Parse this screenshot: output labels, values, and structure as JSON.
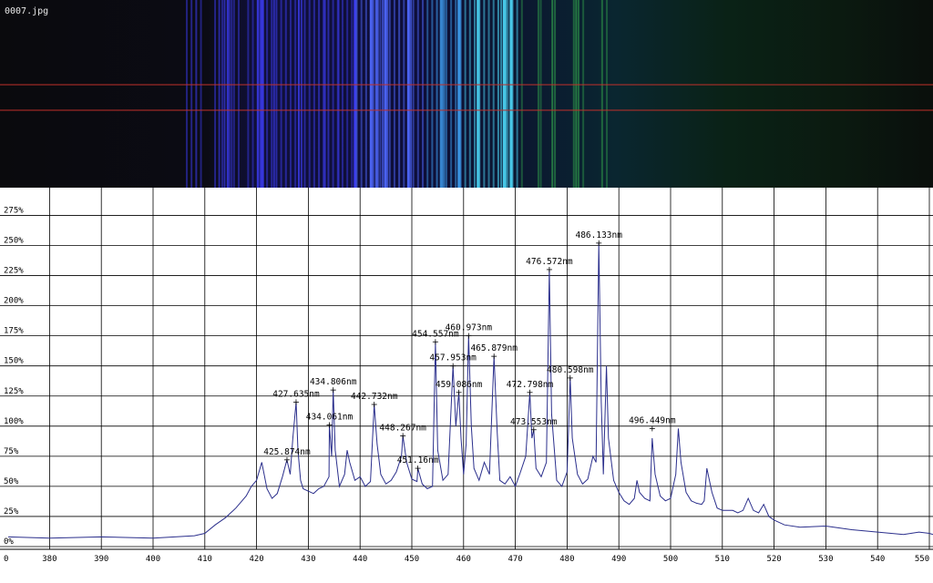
{
  "image": {
    "filename": "0007.jpg"
  },
  "chart_data": {
    "type": "line",
    "xlabel": "",
    "ylabel": "",
    "xlim": [
      372,
      552
    ],
    "ylim": [
      0,
      295
    ],
    "grid": true,
    "x_ticks": [
      "0",
      "380",
      "390",
      "400",
      "410",
      "420",
      "430",
      "440",
      "450",
      "460",
      "470",
      "480",
      "490",
      "500",
      "510",
      "520",
      "530",
      "540",
      "550"
    ],
    "x_tick_values": [
      372,
      380,
      390,
      400,
      410,
      420,
      430,
      440,
      450,
      460,
      470,
      480,
      490,
      500,
      510,
      520,
      530,
      540,
      550
    ],
    "y_ticks": [
      "0%",
      "25%",
      "50%",
      "75%",
      "100%",
      "125%",
      "150%",
      "175%",
      "200%",
      "225%",
      "250%",
      "275%"
    ],
    "y_tick_values": [
      0,
      25,
      50,
      75,
      100,
      125,
      150,
      175,
      200,
      225,
      250,
      275
    ],
    "series": [
      {
        "line_color": "#2b2f8c",
        "x": [
          372,
          380,
          390,
          400,
          408,
          410,
          412,
          414,
          416,
          418,
          419,
          420,
          421,
          422,
          423,
          424,
          425,
          425.87,
          426.5,
          427,
          427.64,
          428,
          428.5,
          429,
          430,
          431,
          432,
          433,
          434,
          434.06,
          434.5,
          434.81,
          435.2,
          436,
          437,
          437.5,
          438,
          439,
          440,
          441,
          442,
          442.73,
          443.3,
          444,
          445,
          446,
          447,
          448,
          448.27,
          449,
          450,
          451,
          451.16,
          452,
          453,
          454,
          454.56,
          455,
          456,
          457,
          457.95,
          458.5,
          459.09,
          459.5,
          460,
          460.5,
          460.97,
          461.5,
          462,
          463,
          464,
          465,
          465.88,
          466.5,
          467,
          468,
          469,
          470,
          471,
          472,
          472.8,
          473.2,
          473.55,
          474,
          475,
          476,
          476.57,
          477,
          478,
          479,
          480,
          480.6,
          481,
          482,
          483,
          484,
          485,
          485.6,
          486.13,
          486.6,
          487,
          487.6,
          488,
          489,
          490,
          491,
          492,
          493,
          493.5,
          494,
          495,
          496,
          496.45,
          497,
          498,
          499,
          500,
          501,
          501.5,
          502,
          503,
          504,
          505,
          506,
          506.5,
          507,
          508,
          509,
          510,
          512,
          513,
          514,
          515,
          516,
          517,
          518,
          519,
          520,
          522,
          525,
          530,
          535,
          540,
          545,
          548,
          550,
          552
        ],
        "y": [
          8,
          7,
          8,
          7,
          9,
          11,
          18,
          24,
          32,
          42,
          50,
          55,
          70,
          48,
          40,
          44,
          58,
          72,
          60,
          90,
          120,
          80,
          55,
          48,
          46,
          44,
          48,
          50,
          58,
          101,
          75,
          130,
          80,
          50,
          60,
          80,
          70,
          55,
          58,
          50,
          54,
          118,
          85,
          60,
          52,
          55,
          62,
          75,
          92,
          70,
          56,
          54,
          65,
          52,
          48,
          50,
          170,
          80,
          55,
          60,
          150,
          100,
          128,
          90,
          60,
          85,
          175,
          100,
          65,
          55,
          70,
          60,
          158,
          95,
          55,
          52,
          58,
          50,
          62,
          75,
          128,
          90,
          97,
          65,
          58,
          70,
          230,
          110,
          55,
          50,
          62,
          140,
          90,
          60,
          52,
          56,
          75,
          70,
          252,
          120,
          60,
          150,
          90,
          55,
          45,
          38,
          35,
          40,
          55,
          45,
          40,
          38,
          90,
          60,
          42,
          38,
          40,
          60,
          98,
          70,
          45,
          38,
          36,
          35,
          38,
          65,
          45,
          32,
          30,
          30,
          28,
          30,
          40,
          30,
          28,
          35,
          25,
          22,
          18,
          16,
          17,
          14,
          12,
          10,
          12,
          11,
          10
        ]
      }
    ],
    "annotations": [
      {
        "label": "425.874nm",
        "x": 425.874,
        "y": 72
      },
      {
        "label": "427.635nm",
        "x": 427.635,
        "y": 120
      },
      {
        "label": "434.061nm",
        "x": 434.061,
        "y": 101
      },
      {
        "label": "434.806nm",
        "x": 434.806,
        "y": 130
      },
      {
        "label": "442.732nm",
        "x": 442.732,
        "y": 118
      },
      {
        "label": "448.267nm",
        "x": 448.267,
        "y": 92
      },
      {
        "label": "451.16nm",
        "x": 451.16,
        "y": 65
      },
      {
        "label": "454.557nm",
        "x": 454.557,
        "y": 170
      },
      {
        "label": "457.953nm",
        "x": 457.953,
        "y": 150
      },
      {
        "label": "459.086nm",
        "x": 459.086,
        "y": 128
      },
      {
        "label": "460.973nm",
        "x": 460.973,
        "y": 175
      },
      {
        "label": "465.879nm",
        "x": 465.879,
        "y": 158
      },
      {
        "label": "472.798nm",
        "x": 472.798,
        "y": 128
      },
      {
        "label": "473.553nm",
        "x": 473.553,
        "y": 97
      },
      {
        "label": "476.572nm",
        "x": 476.572,
        "y": 230
      },
      {
        "label": "480.598nm",
        "x": 480.598,
        "y": 140
      },
      {
        "label": "486.133nm",
        "x": 486.133,
        "y": 252
      },
      {
        "label": "496.449nm",
        "x": 496.449,
        "y": 98
      }
    ]
  }
}
